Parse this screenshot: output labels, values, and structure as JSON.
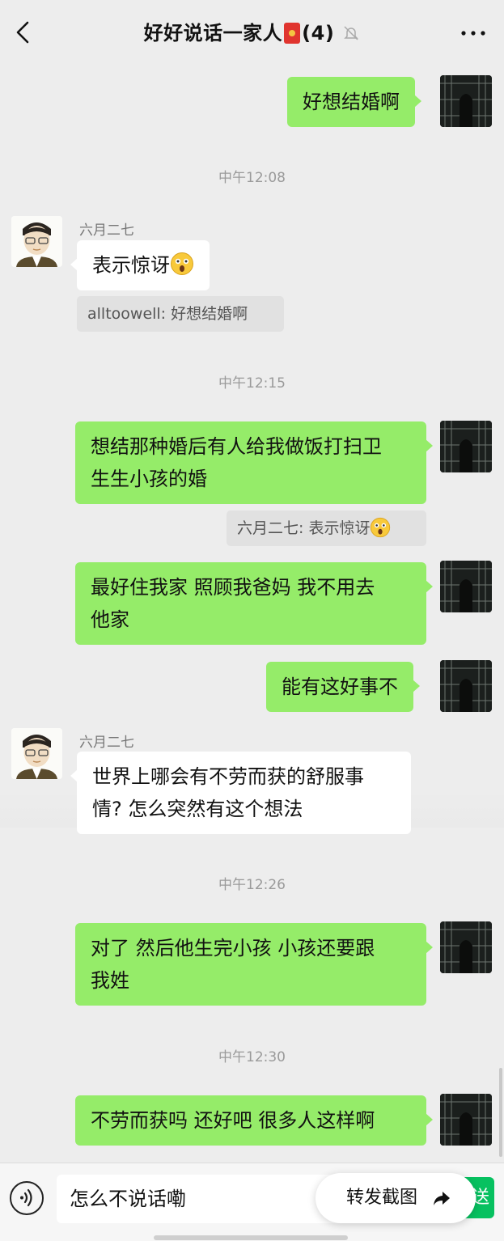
{
  "header": {
    "title": "好好说话一家人",
    "member_count": "(4)",
    "icons": [
      "back-arrow-icon",
      "red-packet-icon",
      "mute-bell-icon",
      "more-icon"
    ]
  },
  "messages": {
    "m1": {
      "text": "好想结婚啊"
    },
    "t1": "中午12:08",
    "m2": {
      "sender": "六月二七",
      "text": "表示惊讶",
      "emoji": "surprised-face-icon",
      "quote": "alltoowell: 好想结婚啊"
    },
    "t2": "中午12:15",
    "m3": {
      "line1": "想结那种婚后有人给我做饭打扫卫",
      "line2": "生生小孩的婚",
      "quote": "六月二七: 表示惊讶"
    },
    "m4": {
      "line1": "最好住我家 照顾我爸妈 我不用去",
      "line2": "他家"
    },
    "m5": {
      "text": "能有这好事不"
    },
    "m6": {
      "sender": "六月二七",
      "line1": "世界上哪会有不劳而获的舒服事",
      "line2": "情? 怎么突然有这个想法"
    },
    "t3": "中午12:26",
    "m7": {
      "line1": "对了 然后他生完小孩 小孩还要跟",
      "line2": "我姓"
    },
    "t4": "中午12:30",
    "m8": {
      "text": "不劳而获吗 还好吧 很多人这样啊"
    }
  },
  "input_bar": {
    "draft_text": "怎么不说话嘞",
    "send_label": "送",
    "forward_label": "转发截图"
  },
  "colors": {
    "bubble_self": "#95ec69",
    "bubble_other": "#ffffff",
    "background": "#ededed",
    "send_button": "#07c160"
  }
}
